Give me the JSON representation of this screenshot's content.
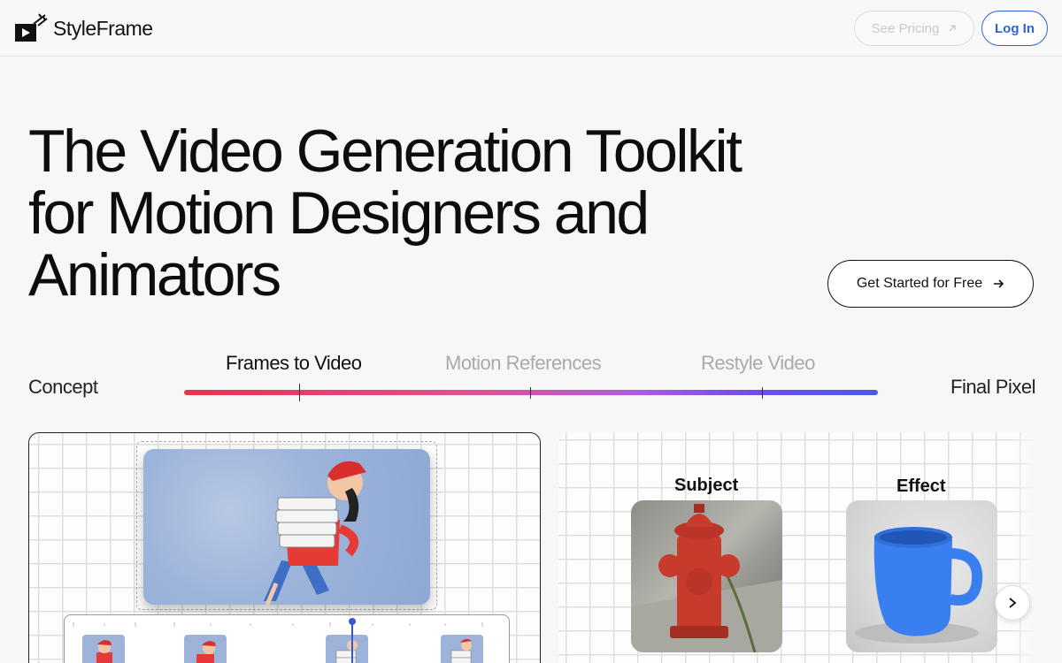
{
  "brand": {
    "name": "StyleFrame"
  },
  "header": {
    "pricing_label": "See Pricing",
    "login_label": "Log In"
  },
  "hero": {
    "title_line1": "The Video Generation Toolkit",
    "title_line2": "for Motion Designers and",
    "title_line3": "Animators",
    "cta_label": "Get Started for Free"
  },
  "pipeline": {
    "start_label": "Concept",
    "end_label": "Final Pixel",
    "steps": [
      "Frames to Video",
      "Motion References",
      "Restyle Video"
    ],
    "active_index": 0
  },
  "demo": {
    "subject_label": "Subject",
    "effect_label": "Effect"
  },
  "colors": {
    "accent": "#2b63d9",
    "gradient_start": "#e8324f",
    "gradient_end": "#4a5ae6"
  },
  "icons": {
    "pricing": "arrow-up-right-icon",
    "cta": "arrow-right-icon",
    "carousel": "chevron-right-icon"
  }
}
